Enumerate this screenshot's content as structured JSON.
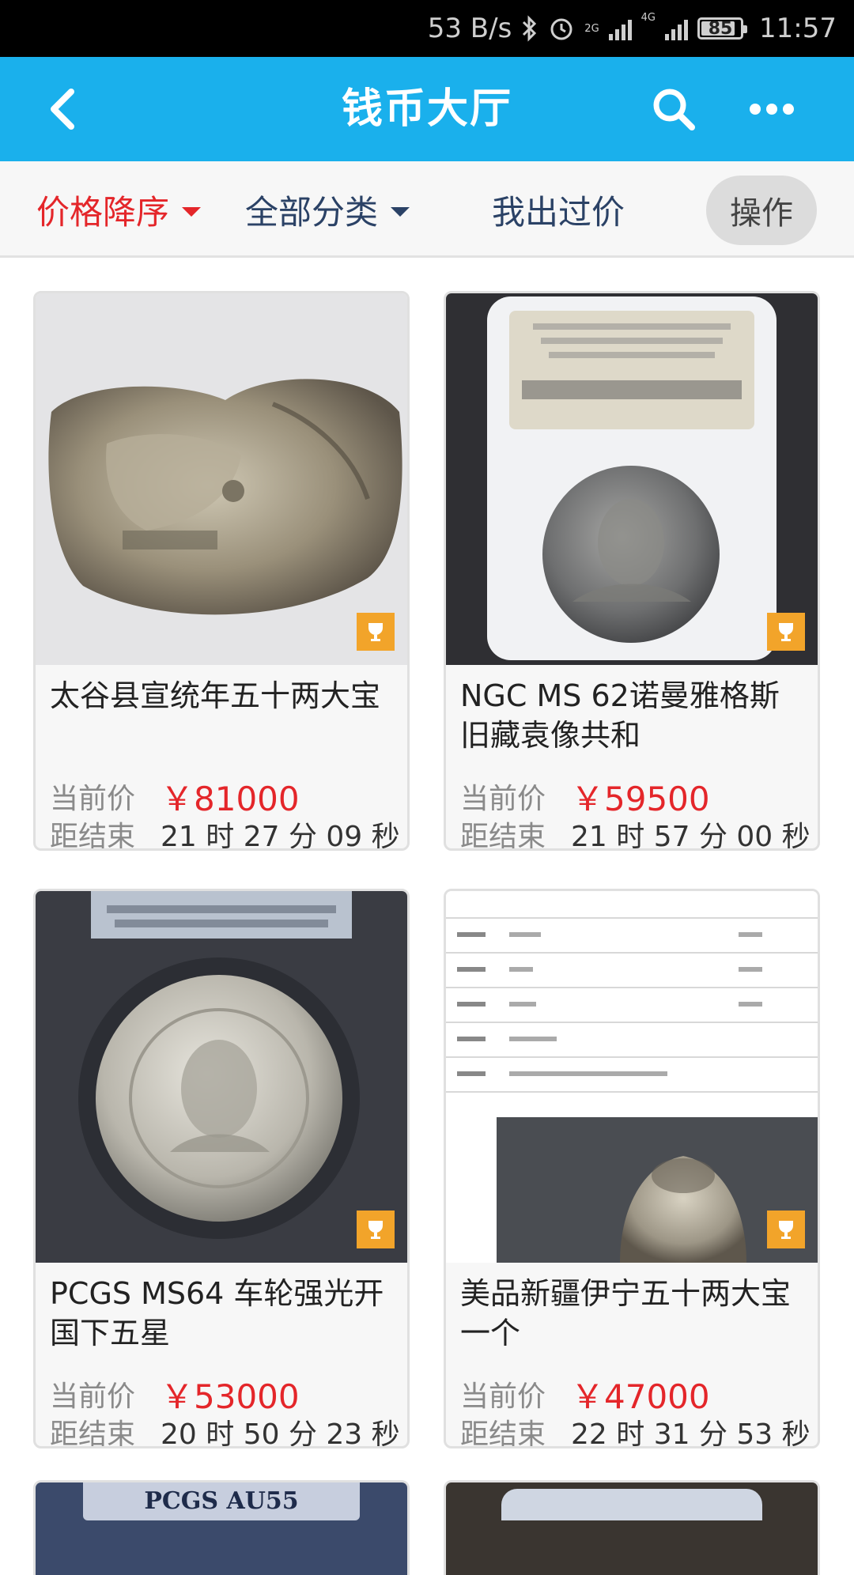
{
  "status_bar": {
    "net_speed": "53 B/s",
    "net_type_1": "2G",
    "net_type_2": "4G",
    "battery": "85",
    "time": "11:57"
  },
  "header": {
    "title": "钱币大厅",
    "back_icon": "back-arrow-icon",
    "search_icon": "search-icon",
    "more_icon": "more-icon",
    "color": "#1ab0ec"
  },
  "filters": {
    "sort_label": "价格降序",
    "category_label": "全部分类",
    "mybids_label": "我出过价",
    "operate_label": "操作",
    "active_color": "#e4262a"
  },
  "labels": {
    "current_price": "当前价",
    "time_left": "距结束"
  },
  "items": [
    {
      "title": "太谷县宣统年五十两大宝",
      "price": "￥81000",
      "countdown": "21 时 27 分 09 秒",
      "photo": "silver-ingot-photo"
    },
    {
      "title": "NGC MS 62诺曼雅格斯旧藏袁像共和",
      "price": "￥59500",
      "countdown": "21 时 57 分 00 秒",
      "photo": "slabbed-coin-photo"
    },
    {
      "title": "PCGS MS64 车轮强光开国下五星",
      "price": "￥53000",
      "countdown": "20 时 50 分 23 秒",
      "photo": "slabbed-coin-photo"
    },
    {
      "title": "美品新疆伊宁五十两大宝一个",
      "price": "￥47000",
      "countdown": "22 时 31 分 53 秒",
      "photo": "certificate-and-ingot-photo"
    }
  ],
  "peek_items": [
    {
      "label": "PCGS AU55"
    },
    {
      "label": ""
    }
  ]
}
